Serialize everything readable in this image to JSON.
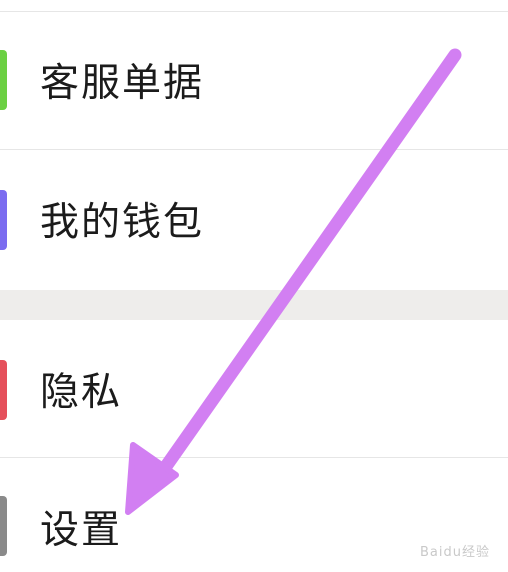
{
  "menu": {
    "items": [
      {
        "label": "客服单据",
        "icon": "ticket-icon",
        "icon_color": "#6bd043"
      },
      {
        "label": "我的钱包",
        "icon": "wallet-icon",
        "icon_color": "#7b6cf0"
      },
      {
        "label": "隐私",
        "icon": "privacy-icon",
        "icon_color": "#e5505b"
      },
      {
        "label": "设置",
        "icon": "settings-icon",
        "icon_color": "#8a8a8a"
      }
    ]
  },
  "annotation": {
    "arrow_color": "#d27ff2"
  },
  "watermark": {
    "text": "Baidu经验"
  }
}
